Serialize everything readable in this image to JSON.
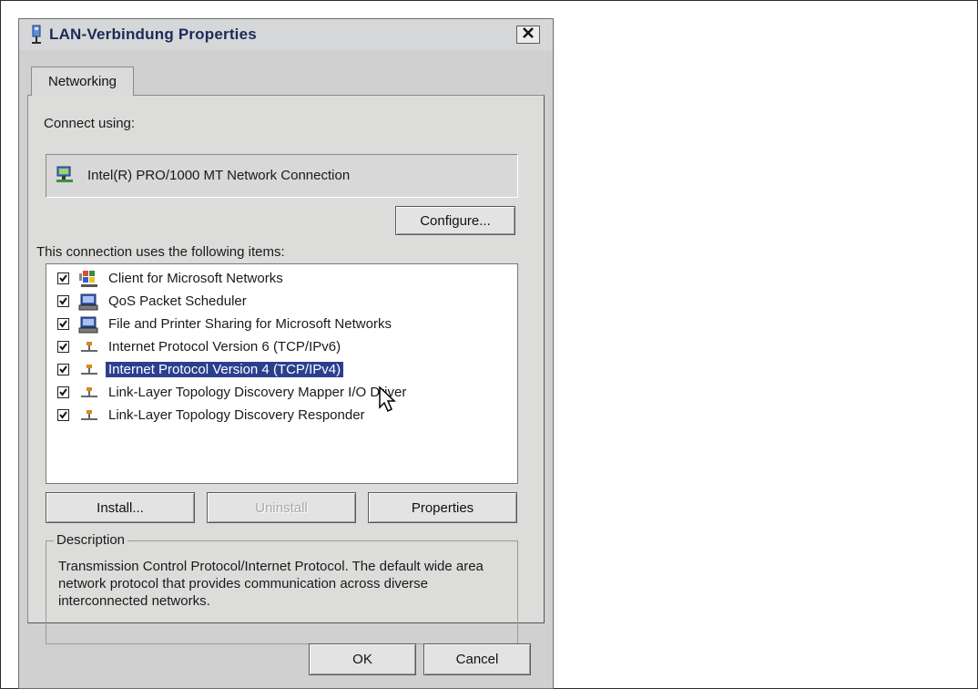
{
  "window": {
    "title": "LAN-Verbindung Properties",
    "close_label": "X"
  },
  "tabs": [
    {
      "label": "Networking"
    }
  ],
  "connect": {
    "label": "Connect using:",
    "adapter": "Intel(R) PRO/1000 MT Network Connection",
    "configure_button": "Configure..."
  },
  "items_section": {
    "label": "This connection uses the following items:",
    "items": [
      {
        "label": "Client for Microsoft Networks",
        "checked": true,
        "icon": "network-client-icon"
      },
      {
        "label": "QoS Packet Scheduler",
        "checked": true,
        "icon": "service-icon"
      },
      {
        "label": "File and Printer Sharing for Microsoft Networks",
        "checked": true,
        "icon": "service-icon"
      },
      {
        "label": "Internet Protocol Version 6 (TCP/IPv6)",
        "checked": true,
        "icon": "protocol-icon"
      },
      {
        "label": "Internet Protocol Version 4 (TCP/IPv4)",
        "checked": true,
        "icon": "protocol-icon",
        "selected": true
      },
      {
        "label": "Link-Layer Topology Discovery Mapper I/O Driver",
        "checked": true,
        "icon": "protocol-icon"
      },
      {
        "label": "Link-Layer Topology Discovery Responder",
        "checked": true,
        "icon": "protocol-icon"
      }
    ]
  },
  "buttons": {
    "install": "Install...",
    "uninstall": "Uninstall",
    "properties": "Properties",
    "ok": "OK",
    "cancel": "Cancel"
  },
  "description": {
    "legend": "Description",
    "text": "Transmission Control Protocol/Internet Protocol. The default wide area network protocol that provides communication across diverse interconnected networks."
  },
  "colors": {
    "selection": "#2b3f8f",
    "dialog_bg": "#cfd0cf",
    "title_text": "#1c2a57"
  }
}
